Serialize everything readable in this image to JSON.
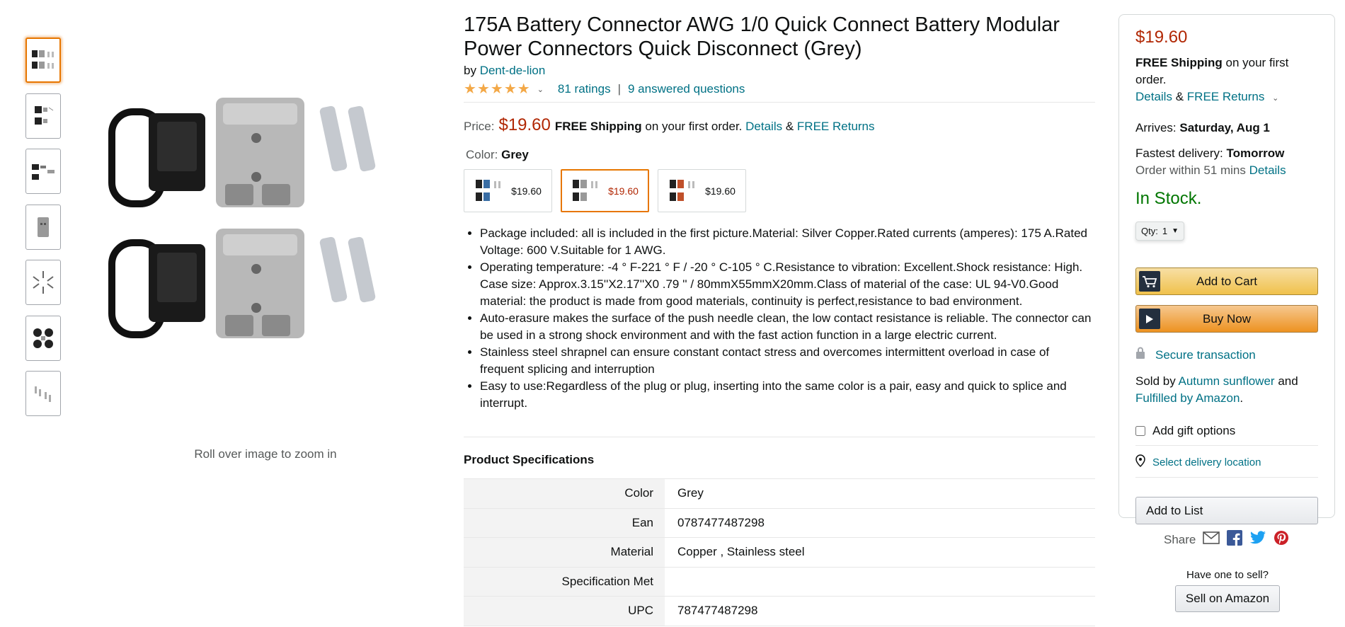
{
  "gallery": {
    "thumbnails": [
      "thumbnail-1",
      "thumbnail-2",
      "thumbnail-3",
      "thumbnail-4",
      "thumbnail-5",
      "thumbnail-6",
      "thumbnail-7"
    ],
    "zoom_hint": "Roll over image to zoom in"
  },
  "product": {
    "title": "175A Battery Connector AWG 1/0 Quick Connect Battery Modular Power Connectors Quick Disconnect (Grey)",
    "by_label": "by",
    "brand": "Dent-de-lion",
    "ratings_count": "81 ratings",
    "separator": "|",
    "answered_questions": "9 answered questions",
    "price_label": "Price:",
    "price": "$19.60",
    "free_shipping": "FREE Shipping",
    "shipping_suffix": "on your first order.",
    "details_link": "Details",
    "ampersand": "&",
    "free_returns": "FREE Returns",
    "color_label": "Color:",
    "color_value": "Grey",
    "swatches": [
      {
        "price": "$19.60",
        "selected": false
      },
      {
        "price": "$19.60",
        "selected": true
      },
      {
        "price": "$19.60",
        "selected": false
      }
    ],
    "bullets": [
      "Package included: all is included in the first picture.Material: Silver Copper.Rated currents (amperes): 175 A.Rated Voltage: 600 V.Suitable for 1 AWG.",
      "Operating temperature: -4 ° F-221 ° F / -20 ° C-105 ° C.Resistance to vibration: Excellent.Shock resistance: High. Case size: Approx.3.15''X2.17''X0 .79 '' / 80mmX55mmX20mm.Class of material of the case: UL 94-V0.Good material: the product is made from good materials, continuity is perfect,resistance to bad environment.",
      "Auto-erasure makes the surface of the push needle clean, the low contact resistance is reliable. The connector can be used in a strong shock environment and with the fast action function in a large electric current.",
      "Stainless steel shrapnel can ensure constant contact stress and overcomes intermittent overload in case of frequent splicing and interruption",
      "Easy to use:Regardless of the plug or plug, inserting into the same color is a pair, easy and quick to splice and interrupt."
    ]
  },
  "specs": {
    "heading": "Product Specifications",
    "rows": [
      {
        "key": "Color",
        "value": "Grey"
      },
      {
        "key": "Ean",
        "value": "0787477487298"
      },
      {
        "key": "Material",
        "value": "Copper , Stainless steel"
      },
      {
        "key": "Specification Met",
        "value": ""
      },
      {
        "key": "UPC",
        "value": "787477487298"
      }
    ]
  },
  "buybox": {
    "price": "$19.60",
    "free_shipping": "FREE Shipping",
    "shipping_suffix": "on your first order.",
    "details": "Details",
    "ampersand": "&",
    "free_returns": "FREE Returns",
    "arrives_label": "Arrives:",
    "arrives_date": "Saturday, Aug 1",
    "fastest_label": "Fastest delivery:",
    "fastest_day": "Tomorrow",
    "order_within": "Order within 51 mins",
    "fastest_details": "Details",
    "stock": "In Stock.",
    "qty_label": "Qty:",
    "qty_value": "1",
    "add_to_cart": "Add to Cart",
    "buy_now": "Buy Now",
    "secure": "Secure transaction",
    "sold_by_label": "Sold by",
    "seller": "Autumn sunflower",
    "and": "and",
    "fulfilled": "Fulfilled by Amazon",
    "period": ".",
    "gift": "Add gift options",
    "delivery_location": "Select delivery location",
    "add_to_list": "Add to List"
  },
  "share": {
    "label": "Share"
  },
  "sell": {
    "question": "Have one to sell?",
    "button": "Sell on Amazon"
  },
  "colors": {
    "price_red": "#b12704",
    "link": "#007185",
    "in_stock": "#007600",
    "selected_orange": "#e77600"
  },
  "icons": [
    "chevron-down-icon",
    "star-icon",
    "cart-icon",
    "play-icon",
    "lock-icon",
    "location-pin-icon",
    "mail-icon",
    "facebook-icon",
    "twitter-icon",
    "pinterest-icon"
  ]
}
